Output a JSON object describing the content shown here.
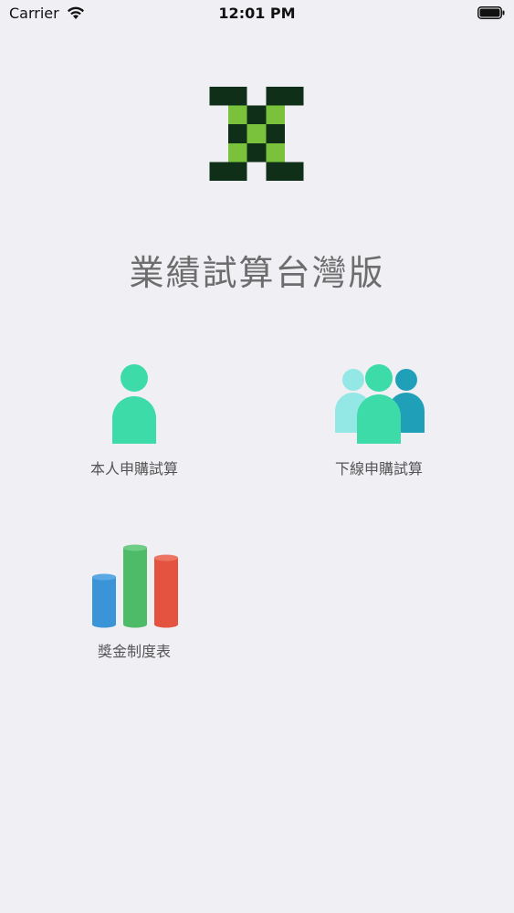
{
  "status_bar": {
    "carrier": "Carrier",
    "time": "12:01 PM",
    "wifi_icon": "wifi-icon",
    "battery_icon": "battery-icon"
  },
  "app": {
    "title": "業績試算台灣版",
    "logo_icon": "checker-x-logo-icon"
  },
  "menu": {
    "self_purchase": {
      "label": "本人申購試算",
      "icon": "person-icon"
    },
    "downline_purchase": {
      "label": "下線申購試算",
      "icon": "group-icon"
    },
    "bonus_table": {
      "label": "獎金制度表",
      "icon": "bar-chart-icon"
    }
  },
  "colors": {
    "background": "#f0eff4",
    "logo_dark": "#0f2f18",
    "logo_light": "#7ac13c",
    "person_green": "#3ddba8",
    "group_light": "#93e8e6",
    "group_dark": "#1fa0b8",
    "bar_blue": "#3b94d8",
    "bar_green": "#4dbb68",
    "bar_red": "#e45340"
  }
}
